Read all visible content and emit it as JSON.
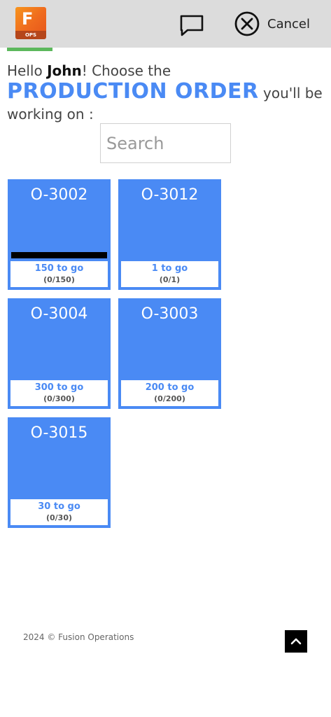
{
  "header": {
    "logo_letter": "F",
    "logo_sub": "OPS",
    "cancel_label": "Cancel"
  },
  "greeting": {
    "prefix": "Hello ",
    "user": "John",
    "middle": "! Choose the",
    "emphasis": "PRODUCTION ORDER",
    "suffix": " you'll be working on :"
  },
  "search": {
    "placeholder": "Search",
    "value": ""
  },
  "orders": [
    {
      "id": "O-3002",
      "to_go": "150 to go",
      "count": "(0/150)",
      "has_bar": true
    },
    {
      "id": "O-3012",
      "to_go": "1 to go",
      "count": "(0/1)",
      "has_bar": false
    },
    {
      "id": "O-3004",
      "to_go": "300 to go",
      "count": "(0/300)",
      "has_bar": false
    },
    {
      "id": "O-3003",
      "to_go": "200 to go",
      "count": "(0/200)",
      "has_bar": false
    },
    {
      "id": "O-3015",
      "to_go": "30 to go",
      "count": "(0/30)",
      "has_bar": false
    }
  ],
  "footer": {
    "copyright": "2024 © Fusion Operations"
  },
  "colors": {
    "accent": "#4a8af4",
    "topbar": "#dcdcdc",
    "progress": "#5cb85c",
    "logo": "#f7941d"
  },
  "icons": {
    "chat": "chat-icon",
    "cancel": "close-circle-icon",
    "scroll_top": "chevron-up-icon"
  }
}
